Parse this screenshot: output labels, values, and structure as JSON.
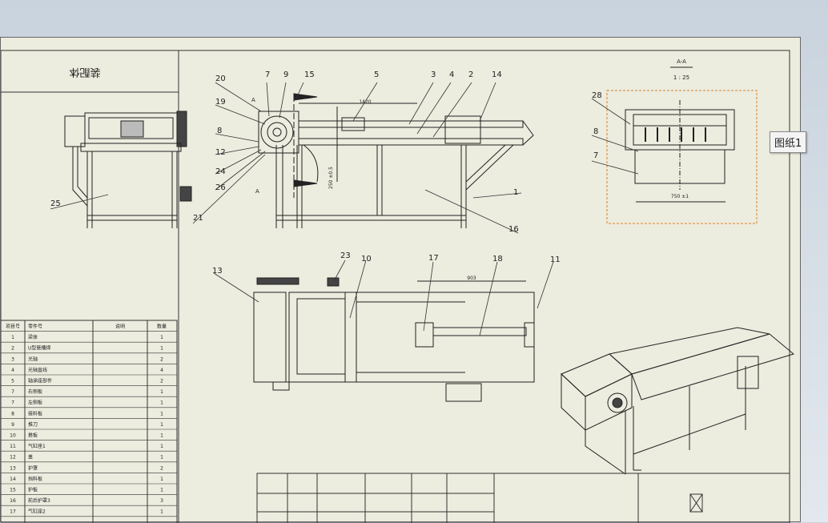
{
  "title_block": {
    "title": "装配体",
    "section": "A-A",
    "scale": "1 : 25"
  },
  "tooltip": "图纸1",
  "dims": {
    "d1": "1420",
    "d2": "250 ±0.5",
    "d3": "750 ±1",
    "d4": "903"
  },
  "section_marks": {
    "top": "A",
    "bottom": "A"
  },
  "callouts": [
    "20",
    "7",
    "9",
    "15",
    "5",
    "3",
    "4",
    "2",
    "14",
    "19",
    "8",
    "12",
    "24",
    "26",
    "21",
    "25",
    "1",
    "16",
    "13",
    "23",
    "10",
    "17",
    "18",
    "11",
    "28",
    "8",
    "7"
  ],
  "bom": {
    "headers": [
      "项目号",
      "零件号",
      "说明",
      "数量"
    ],
    "rows": [
      [
        "1",
        "梁体",
        "",
        "1"
      ],
      [
        "2",
        "U型管槽焊",
        "",
        "1"
      ],
      [
        "3",
        "光轴",
        "",
        "2"
      ],
      [
        "4",
        "光轴直线",
        "",
        "4"
      ],
      [
        "5",
        "轴承座部件",
        "",
        "2"
      ],
      [
        "7",
        "右侧板",
        "",
        "1"
      ],
      [
        "7",
        "左侧板",
        "",
        "1"
      ],
      [
        "8",
        "接料板",
        "",
        "1"
      ],
      [
        "9",
        "推刀",
        "",
        "1"
      ],
      [
        "10",
        "推板",
        "",
        "1"
      ],
      [
        "11",
        "气缸座1",
        "",
        "1"
      ],
      [
        "12",
        "盖",
        "",
        "1"
      ],
      [
        "13",
        "护罩",
        "",
        "2"
      ],
      [
        "14",
        "挡料板",
        "",
        "1"
      ],
      [
        "15",
        "护板",
        "",
        "1"
      ],
      [
        "16",
        "前后护罩3",
        "",
        "3"
      ],
      [
        "17",
        "气缸座2",
        "",
        "1"
      ]
    ]
  }
}
